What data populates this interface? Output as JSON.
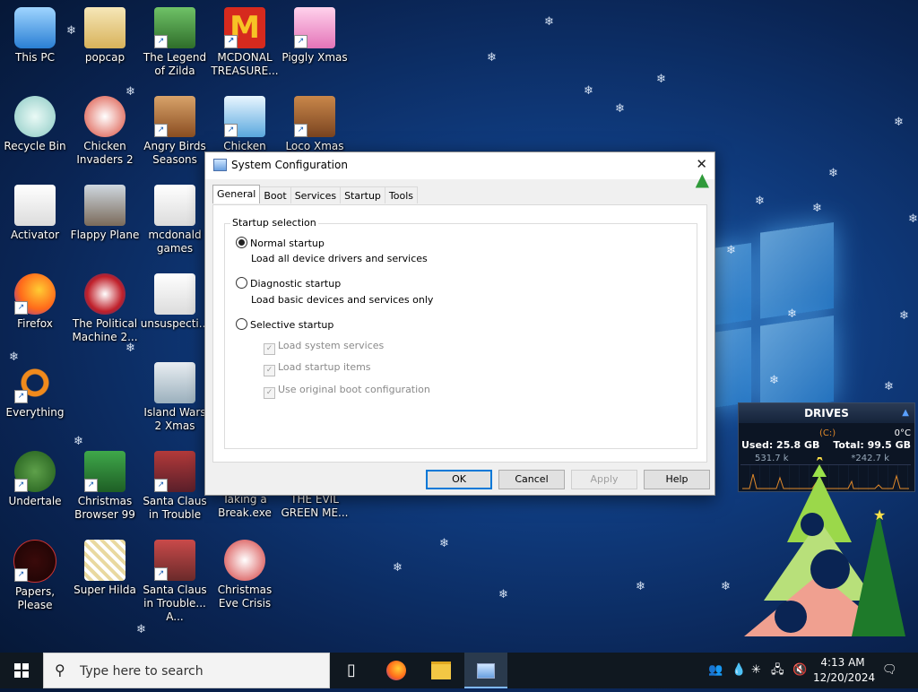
{
  "desktop": {
    "icons": [
      {
        "label": "This PC"
      },
      {
        "label": "popcap"
      },
      {
        "label": "The Legend of Zilda"
      },
      {
        "label": "MCDONAL TREASURE..."
      },
      {
        "label": "Piggly Xmas"
      },
      {
        "label": "Recycle Bin"
      },
      {
        "label": "Chicken Invaders 2"
      },
      {
        "label": "Angry Birds Seasons"
      },
      {
        "label": "Chicken"
      },
      {
        "label": "Loco Xmas"
      },
      {
        "label": "Activator"
      },
      {
        "label": "Flappy Plane"
      },
      {
        "label": "mcdonald games"
      },
      {
        "label": "Firefox"
      },
      {
        "label": "The Political Machine 2..."
      },
      {
        "label": "unsuspecti..."
      },
      {
        "label": "Everything"
      },
      {
        "label": "Island Wars 2 Xmas"
      },
      {
        "label": "Undertale"
      },
      {
        "label": "Christmas Browser 99"
      },
      {
        "label": "Santa Claus in Trouble"
      },
      {
        "label": "Taking a Break.exe"
      },
      {
        "label": "THE EVIL GREEN ME..."
      },
      {
        "label": "Papers, Please"
      },
      {
        "label": "Super Hilda"
      },
      {
        "label": "Santa Claus in Trouble... A..."
      },
      {
        "label": "Christmas Eve Crisis"
      }
    ]
  },
  "dialog": {
    "title": "System Configuration",
    "close": "✕",
    "tabs": [
      "General",
      "Boot",
      "Services",
      "Startup",
      "Tools"
    ],
    "active_tab": "General",
    "group_label": "Startup selection",
    "options": [
      {
        "label": "Normal startup",
        "desc": "Load all device drivers and services",
        "selected": true
      },
      {
        "label": "Diagnostic startup",
        "desc": "Load basic devices and services only",
        "selected": false
      },
      {
        "label": "Selective startup",
        "desc": "",
        "selected": false
      }
    ],
    "checks": [
      {
        "label": "Load system services",
        "checked": true
      },
      {
        "label": "Load startup items",
        "checked": true
      },
      {
        "label": "Use original boot configuration",
        "checked": true
      }
    ],
    "buttons": {
      "ok": "OK",
      "cancel": "Cancel",
      "apply": "Apply",
      "help": "Help"
    }
  },
  "drives_widget": {
    "title": "DRIVES",
    "drive": "(C:)",
    "temp": "0°C",
    "used": "Used: 25.8 GB",
    "total": "Total: 99.5 GB",
    "read": "531.7 k",
    "write": "*242.7 k"
  },
  "taskbar": {
    "search_placeholder": "Type here to search",
    "time": "4:13 AM",
    "date": "12/20/2024"
  },
  "colors": {
    "accent": "#0078d7",
    "desktop": "#0f3a7c",
    "taskbar": "#101820"
  }
}
